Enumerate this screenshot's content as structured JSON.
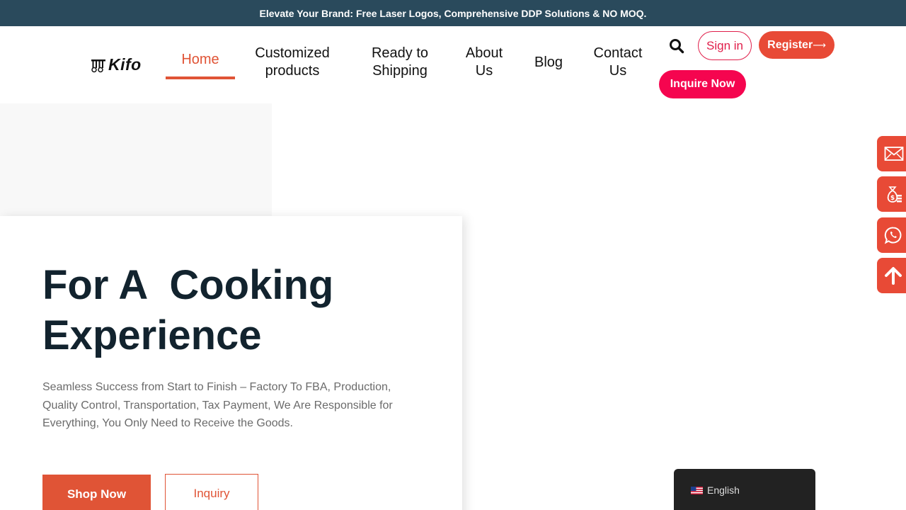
{
  "topbar": {
    "text": "Elevate Your Brand: Free Laser Logos, Comprehensive DDP Solutions & NO MOQ."
  },
  "logo": {
    "text": "Kifo"
  },
  "nav": {
    "home": "Home",
    "customized_line1": "Customized",
    "customized_line2": "products",
    "ready_line1": "Ready to",
    "ready_line2": "Shipping",
    "about_line1": "About",
    "about_line2": "Us",
    "blog": "Blog",
    "contact_line1": "Contact",
    "contact_line2": "Us"
  },
  "header_actions": {
    "search_icon": "search-icon",
    "sign_in": "Sign in",
    "register": "Register",
    "register_arrow": "⟶",
    "inquire_now": "Inquire Now"
  },
  "hero": {
    "title_line1": "For A  Cooking",
    "title_line2": "Experience",
    "description": "Seamless Success from Start to Finish – Factory To FBA, Production, Quality Control, Transportation, Tax Payment, We Are Responsible for Everything, You Only Need to Receive the Goods.",
    "shop_now": "Shop Now",
    "inquiry": "Inquiry"
  },
  "side_buttons": [
    "email-icon",
    "money-bag-icon",
    "whatsapp-icon",
    "arrow-up-icon"
  ],
  "language": {
    "label": "English",
    "flag_icon": "us-flag-icon"
  },
  "colors": {
    "topbar_bg": "#2a4a5c",
    "accent": "#e05436",
    "register_bg": "#e84a36",
    "inquire_bg": "#f5054f",
    "heading": "#12232e"
  }
}
